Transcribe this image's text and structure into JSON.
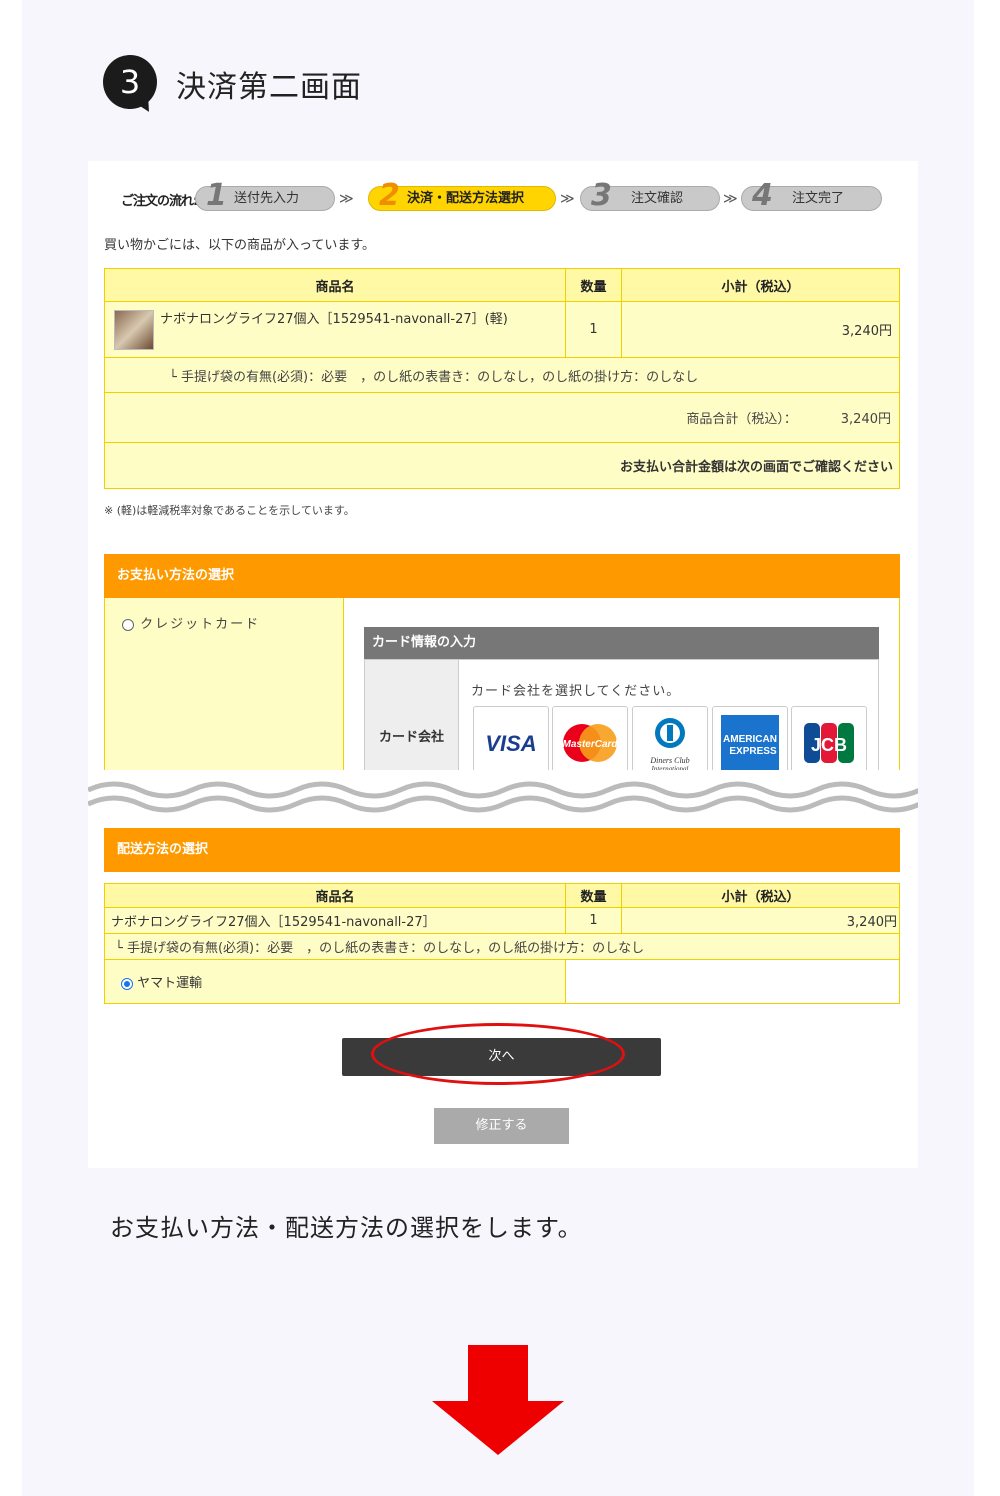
{
  "step": {
    "number": "3",
    "title": "決済第二画面"
  },
  "flow": {
    "label": "ご注文の流れ:",
    "steps": [
      {
        "num": "1",
        "label": "送付先入力"
      },
      {
        "num": "2",
        "label": "決済・配送方法選択"
      },
      {
        "num": "3",
        "label": "注文確認"
      },
      {
        "num": "4",
        "label": "注文完了"
      }
    ],
    "arrow": "≫"
  },
  "cart": {
    "intro": "買い物かごには、以下の商品が入っています。",
    "headers": {
      "name": "商品名",
      "qty": "数量",
      "subtotal": "小計（税込）"
    },
    "item": {
      "name": "ナボナロングライフ27個入［1529541-navonall-27］(軽)",
      "qty": "1",
      "subtotal": "3,240円"
    },
    "options": "└ 手提げ袋の有無(必須)：必要　，のし紙の表書き：のしなし，のし紙の掛け方：のしなし",
    "total_label": "商品合計（税込）：",
    "total_value": "3,240円",
    "confirm_note": "お支払い合計金額は次の画面でご確認ください",
    "footnote": "※ (軽)は軽減税率対象であることを示しています。"
  },
  "payment": {
    "heading": "お支払い方法の選択",
    "option": "クレジットカード",
    "card_heading": "カード情報の入力",
    "card_label": "カード会社",
    "card_instruction": "カード会社を選択してください。",
    "logos": [
      "VISA",
      "MasterCard",
      "Diners Club International",
      "AMERICAN EXPRESS",
      "JCB"
    ]
  },
  "shipping": {
    "heading": "配送方法の選択",
    "headers": {
      "name": "商品名",
      "qty": "数量",
      "subtotal": "小計（税込）"
    },
    "item": {
      "name": "ナボナロングライフ27個入［1529541-navonall-27］",
      "qty": "1",
      "subtotal": "3,240円"
    },
    "options": "└ 手提げ袋の有無(必須)：必要　，のし紙の表書き：のしなし，のし紙の掛け方：のしなし",
    "method": "ヤマト運輸"
  },
  "buttons": {
    "next": "次へ",
    "fix": "修正する"
  },
  "caption": "お支払い方法・配送方法の選択をします。",
  "colors": {
    "accent": "#ff9900",
    "highlight": "#ffd400",
    "table_bg": "#fffdc6",
    "annotation": "#e01010"
  }
}
